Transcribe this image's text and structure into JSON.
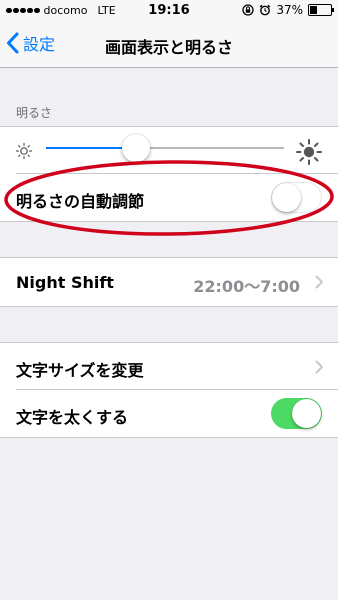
{
  "status_bar": {
    "carrier": "docomo",
    "network": "LTE",
    "time": "19:16",
    "battery": "37%"
  },
  "nav": {
    "back_label": "設定",
    "title": "画面表示と明るさ"
  },
  "brightness": {
    "section_header": "明るさ",
    "slider_level": 0.38,
    "auto_label": "明るさの自動調節",
    "auto_enabled": false
  },
  "night_shift": {
    "label": "Night Shift",
    "value": "22:00〜7:00"
  },
  "text_settings": {
    "size_label": "文字サイズを変更",
    "bold_label": "文字を太くする",
    "bold_enabled": true
  },
  "colors": {
    "accent": "#007aff",
    "toggle_on": "#4cd964",
    "annotation": "#d0021b"
  },
  "icons": [
    "sun-small-icon",
    "sun-large-icon",
    "chevron-right-icon",
    "back-chevron-icon",
    "alarm-icon",
    "rotation-lock-icon"
  ]
}
